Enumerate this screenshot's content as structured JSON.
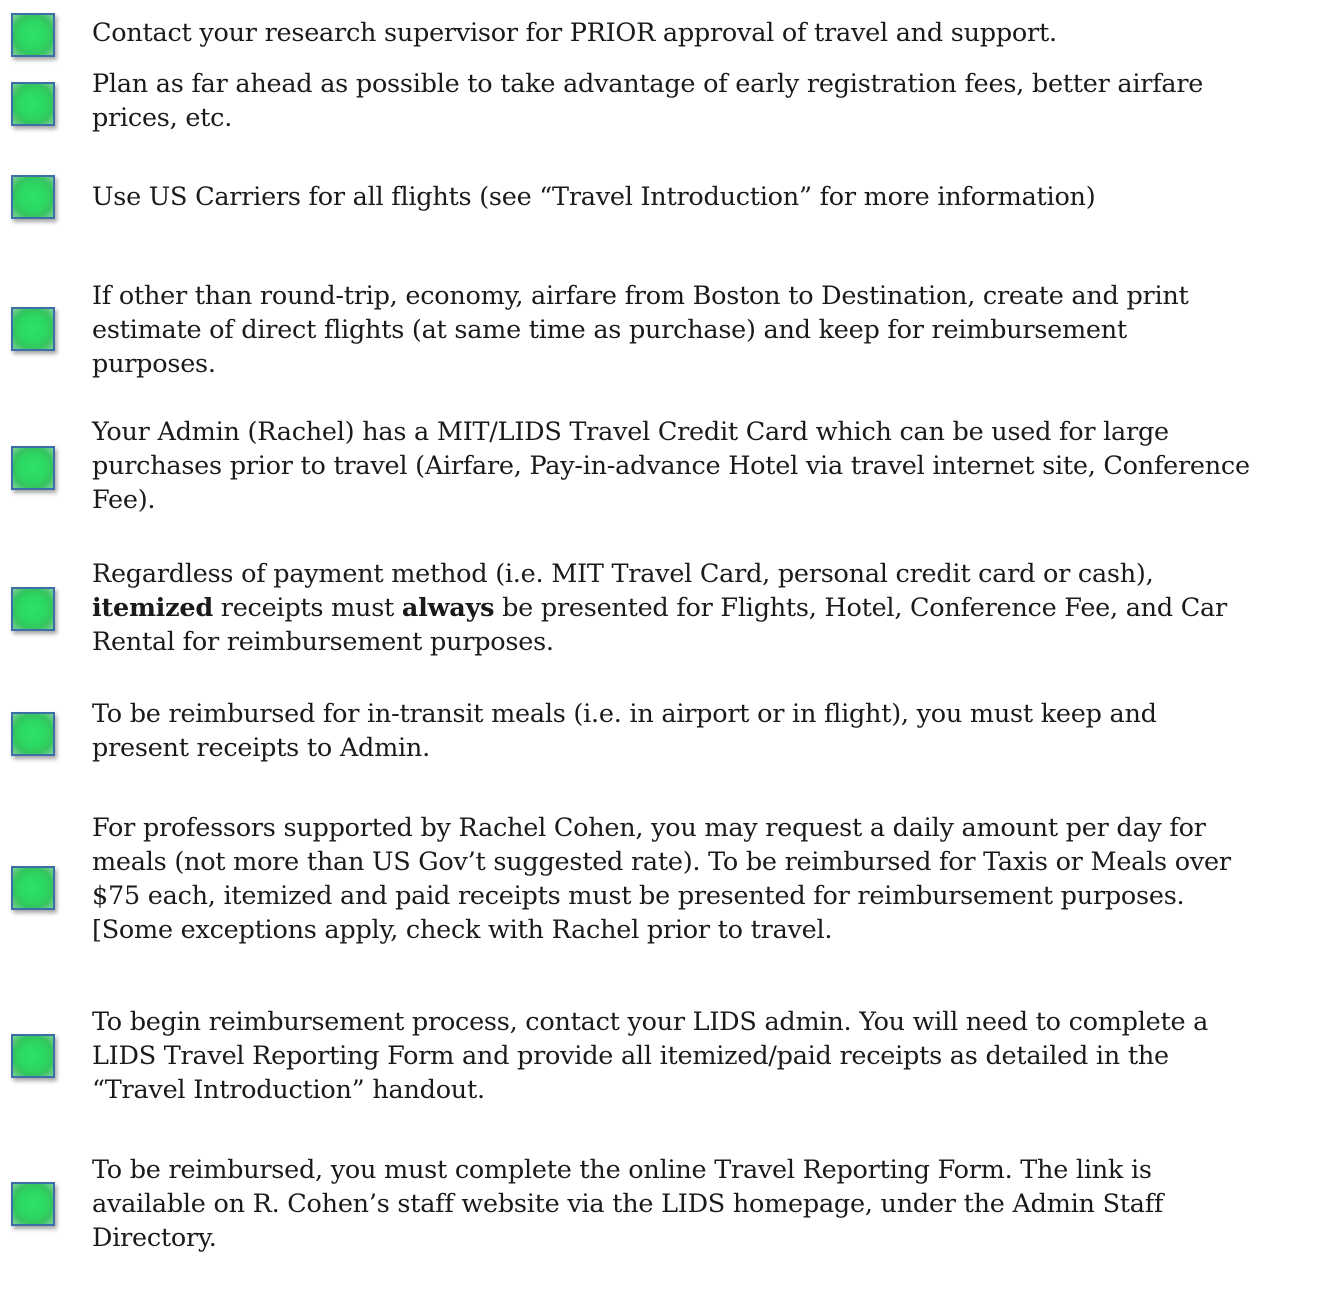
{
  "checklist": {
    "items": [
      {
        "lines": [
          "Contact your research supervisor for PRIOR approval of travel and support."
        ]
      },
      {
        "lines": [
          "Plan as far ahead as possible to take advantage of early registration fees, better airfare",
          "prices, etc."
        ]
      },
      {
        "lines": [
          "Use US Carriers for all flights (see “Travel Introduction” for more information)"
        ]
      },
      {
        "lines": [
          "If other than round-trip, economy, airfare from Boston to Destination, create and print",
          "estimate of direct flights (at same time as purchase) and keep for reimbursement",
          "purposes."
        ]
      },
      {
        "lines": [
          "Your Admin (Rachel) has a MIT/LIDS Travel Credit Card which can be used for large",
          "purchases prior to travel (Airfare, Pay-in-advance Hotel via travel internet site, Conference",
          "Fee)."
        ]
      },
      {
        "lines": [
          "Regardless of payment method (i.e. MIT Travel Card, personal credit card or cash),",
          "itemized",
          "receipts must",
          "always",
          "be presented for Flights, Hotel, Conference Fee, and Car",
          "Rental for reimbursement purposes."
        ]
      },
      {
        "lines": [
          "To be reimbursed for in-transit meals (i.e. in airport or in flight), you must keep and",
          "present receipts to Admin."
        ]
      },
      {
        "lines": [
          "For professors supported by Rachel Cohen, you may request a daily amount per day for",
          "meals (not more than US Gov’t suggested rate). To be reimbursed for Taxis or Meals over",
          "$75 each, itemized and paid receipts must be presented for reimbursement purposes.",
          "[Some exceptions apply, check with Rachel prior to travel."
        ]
      },
      {
        "lines": [
          "To begin reimbursement process, contact your LIDS admin.  You will need to complete a",
          "LIDS Travel Reporting Form and provide all itemized/paid receipts as detailed in the",
          "“Travel Introduction” handout."
        ]
      },
      {
        "lines": [
          "To be reimbursed, you must complete the online Travel Reporting Form.  The link is",
          "available on R. Cohen’s staff website via the LIDS homepage, under the Admin Staff",
          "Directory."
        ]
      }
    ]
  }
}
